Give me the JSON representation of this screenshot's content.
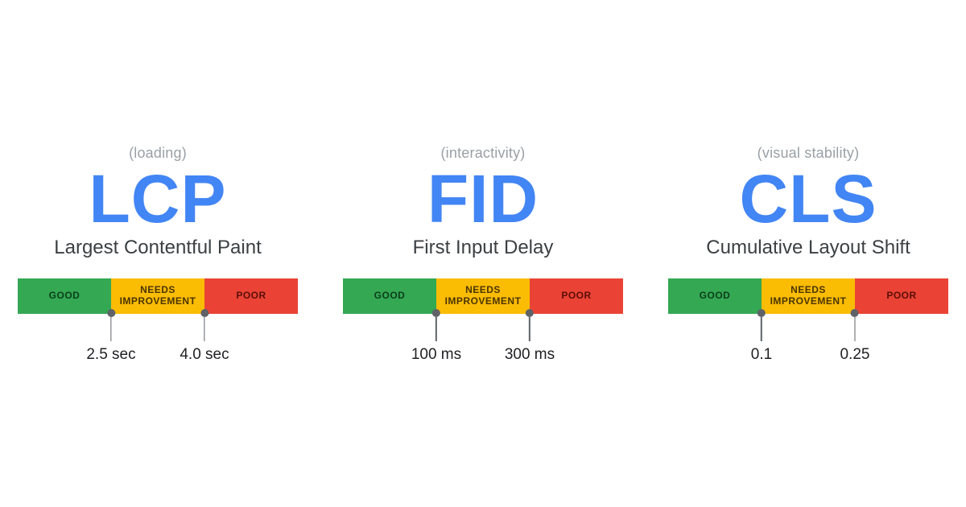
{
  "colors": {
    "accent": "#4285f4",
    "good": "#34a853",
    "needs_improvement": "#fbbc04",
    "poor": "#ea4335"
  },
  "segment_labels": {
    "good": "GOOD",
    "mid": "NEEDS\nIMPROVEMENT",
    "poor": "POOR"
  },
  "metrics": [
    {
      "category": "(loading)",
      "abbr": "LCP",
      "fullname": "Largest Contentful Paint",
      "thresholds": [
        "2.5 sec",
        "4.0 sec"
      ]
    },
    {
      "category": "(interactivity)",
      "abbr": "FID",
      "fullname": "First Input Delay",
      "thresholds": [
        "100 ms",
        "300 ms"
      ]
    },
    {
      "category": "(visual stability)",
      "abbr": "CLS",
      "fullname": "Cumulative Layout Shift",
      "thresholds": [
        "0.1",
        "0.25"
      ]
    }
  ]
}
